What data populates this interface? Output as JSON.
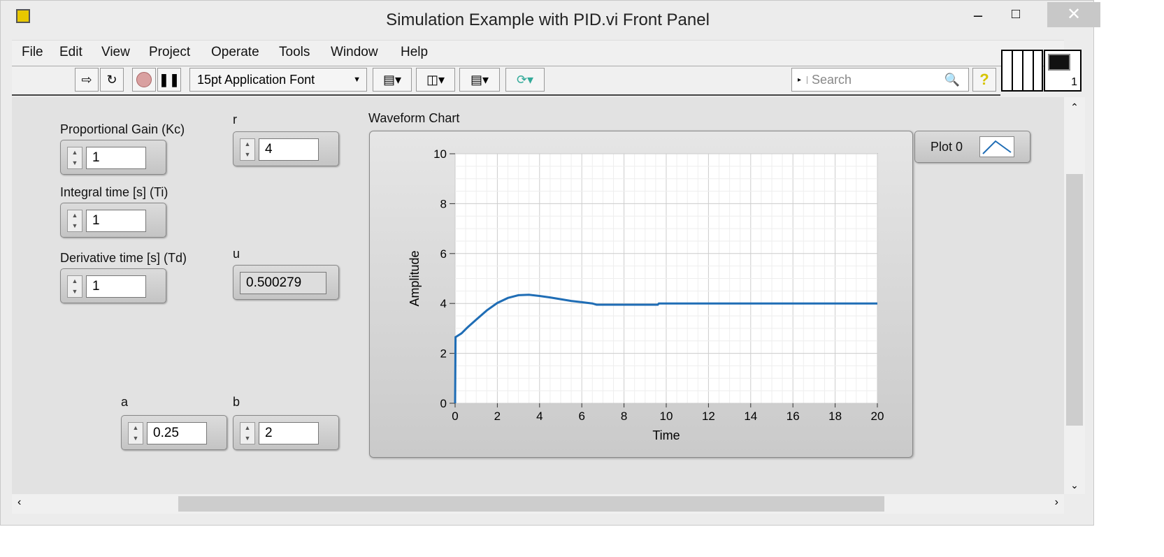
{
  "window": {
    "title": "Simulation Example with PID.vi Front Panel"
  },
  "menu": [
    "File",
    "Edit",
    "View",
    "Project",
    "Operate",
    "Tools",
    "Window",
    "Help"
  ],
  "toolbar": {
    "font": "15pt Application Font",
    "search_placeholder": "Search",
    "connector_number": "1"
  },
  "controls": {
    "kc": {
      "label": "Proportional Gain (Kc)",
      "value": "1"
    },
    "ti": {
      "label": "Integral time [s] (Ti)",
      "value": "1"
    },
    "td": {
      "label": "Derivative time [s] (Td)",
      "value": "1"
    },
    "r": {
      "label": "r",
      "value": "4"
    },
    "u": {
      "label": "u",
      "value": "0.500279"
    },
    "a": {
      "label": "a",
      "value": "0.25"
    },
    "b": {
      "label": "b",
      "value": "2"
    }
  },
  "legend": {
    "plot_name": "Plot 0"
  },
  "chart_data": {
    "type": "line",
    "title": "Waveform Chart",
    "xlabel": "Time",
    "ylabel": "Amplitude",
    "xlim": [
      0,
      20
    ],
    "ylim": [
      0,
      10
    ],
    "xticks": [
      "0",
      "2",
      "4",
      "6",
      "8",
      "10",
      "12",
      "14",
      "16",
      "18",
      "20"
    ],
    "yticks": [
      "0",
      "2",
      "4",
      "6",
      "8",
      "10"
    ],
    "grid": true,
    "color": "#1f6db5",
    "series": [
      {
        "name": "Plot 0",
        "x": [
          0,
          0.02,
          0.3,
          0.6,
          1,
          1.5,
          2,
          2.5,
          3,
          3.5,
          4,
          4.5,
          5,
          5.5,
          6,
          6.5,
          6.7,
          9.6,
          9.65,
          20
        ],
        "y": [
          0,
          2.65,
          2.8,
          3.05,
          3.35,
          3.72,
          4.02,
          4.22,
          4.33,
          4.35,
          4.3,
          4.24,
          4.17,
          4.1,
          4.05,
          4.0,
          3.95,
          3.95,
          4.0,
          4.0
        ]
      }
    ]
  }
}
